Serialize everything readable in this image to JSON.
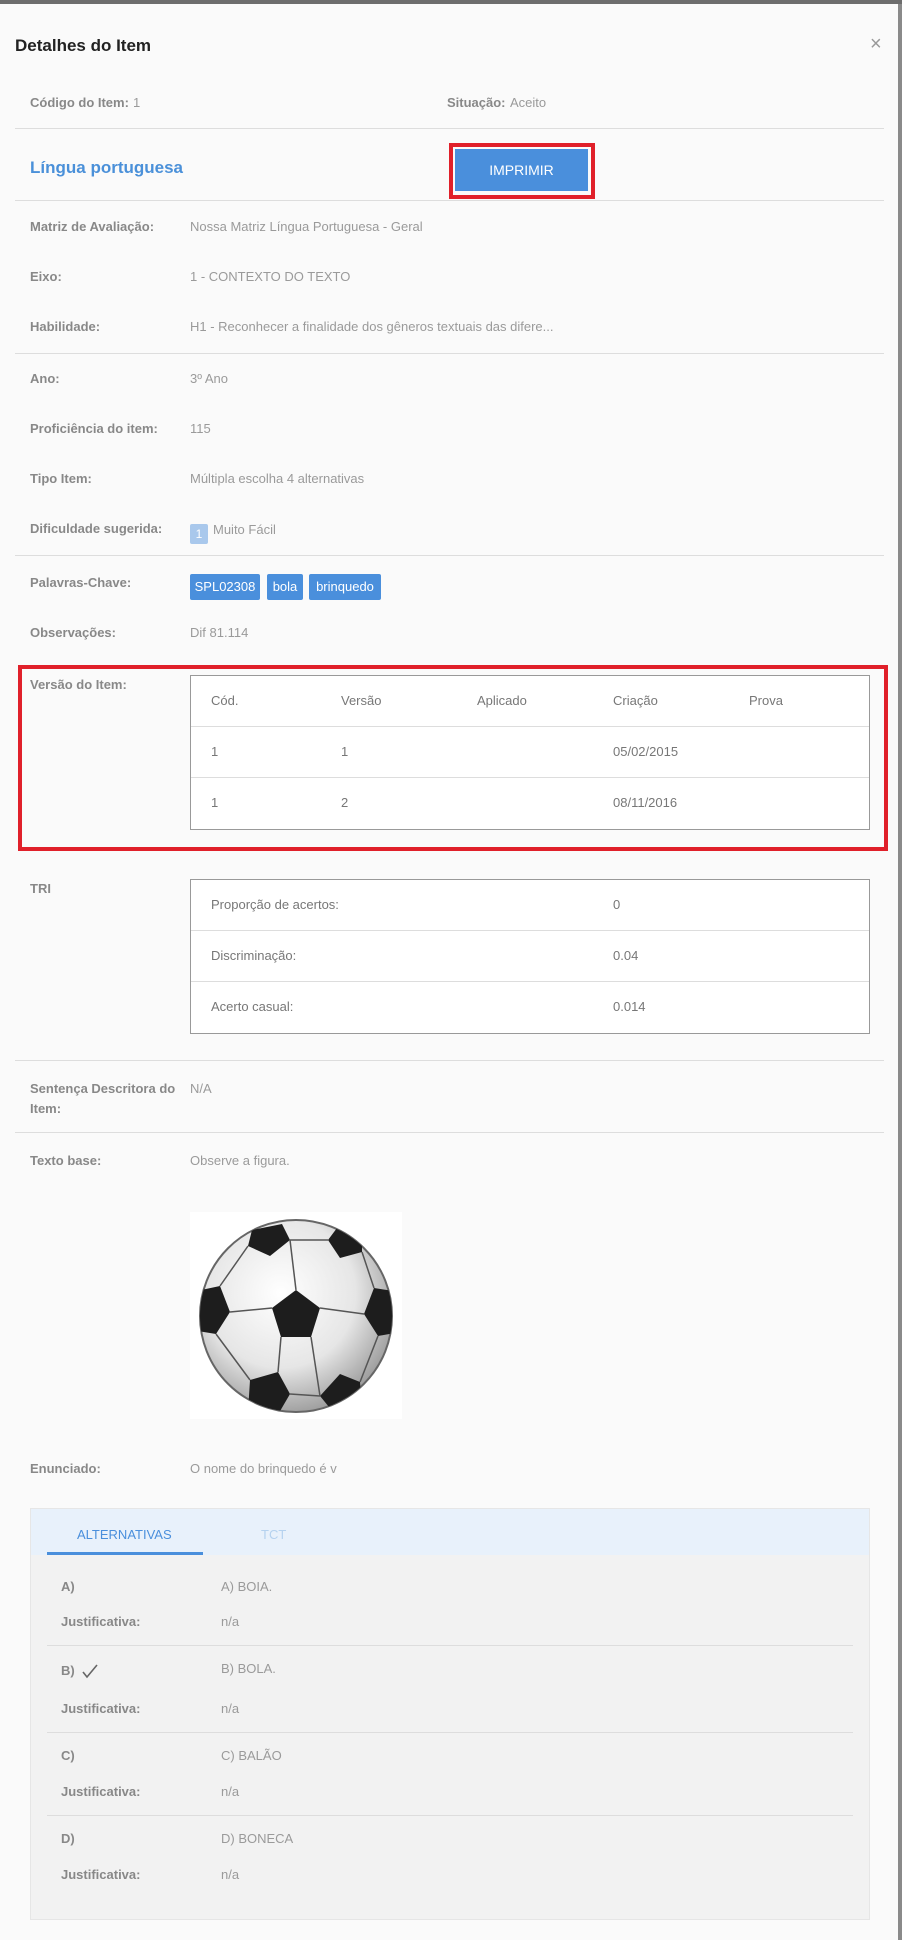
{
  "modal": {
    "title": "Detalhes do Item",
    "close_symbol": "×"
  },
  "header": {
    "code_label": "Código do Item:",
    "code_value": "1",
    "status_label": "Situação:",
    "status_value": "Aceito",
    "subject": "Língua portuguesa",
    "print_button": "IMPRIMIR"
  },
  "fields": {
    "matrix_label": "Matriz de Avaliação:",
    "matrix_value": "Nossa Matriz Língua Portuguesa - Geral",
    "axis_label": "Eixo:",
    "axis_value": "1 - CONTEXTO DO TEXTO",
    "skill_label": "Habilidade:",
    "skill_value": "H1 - Reconhecer a finalidade dos gêneros textuais das difere...",
    "year_label": "Ano:",
    "year_value": "3º Ano",
    "proficiency_label": "Proficiência do item:",
    "proficiency_value": "115",
    "type_label": "Tipo Item:",
    "type_value": "Múltipla escolha 4 alternativas",
    "difficulty_label": "Dificuldade sugerida:",
    "difficulty_level": "1",
    "difficulty_value": "Muito Fácil",
    "keywords_label": "Palavras-Chave:",
    "keywords": [
      "SPL02308",
      "bola",
      "brinquedo"
    ],
    "notes_label": "Observações:",
    "notes_value": "Dif 81.114"
  },
  "versions": {
    "label": "Versão do Item:",
    "headers": [
      "Cód.",
      "Versão",
      "Aplicado",
      "Criação",
      "Prova"
    ],
    "rows": [
      [
        "1",
        "1",
        "",
        "05/02/2015",
        ""
      ],
      [
        "1",
        "2",
        "",
        "08/11/2016",
        ""
      ]
    ]
  },
  "tri": {
    "label": "TRI",
    "rows": [
      [
        "Proporção de acertos:",
        "0"
      ],
      [
        "Discriminação:",
        "0.04"
      ],
      [
        "Acerto casual:",
        "0.014"
      ]
    ]
  },
  "descriptor": {
    "label_line1": "Sentença Descritora do",
    "label_line2": "Item:",
    "value": "N/A"
  },
  "base_text": {
    "label": "Texto base:",
    "value": "Observe a figura."
  },
  "statement": {
    "label": "Enunciado:",
    "value": "O nome do brinquedo é v"
  },
  "tabs": {
    "alternatives": "ALTERNATIVAS",
    "tct": "TCT",
    "active_color": "#4a8fdc",
    "inactive_color": "#b5d2ef"
  },
  "alternatives": [
    {
      "letter": "A)",
      "text": "A) BOIA.",
      "justification_label": "Justificativa:",
      "justification": "n/a",
      "correct": false
    },
    {
      "letter": "B)",
      "text": "B) BOLA.",
      "justification_label": "Justificativa:",
      "justification": "n/a",
      "correct": true
    },
    {
      "letter": "C)",
      "text": "C) BALÃO",
      "justification_label": "Justificativa:",
      "justification": "n/a",
      "correct": false
    },
    {
      "letter": "D)",
      "text": "D) BONECA",
      "justification_label": "Justificativa:",
      "justification": "n/a",
      "correct": false
    }
  ],
  "colors": {
    "accent": "#4a8fdc",
    "highlight_border": "#e0202a",
    "difficulty_badge": "#a9c8ec"
  }
}
